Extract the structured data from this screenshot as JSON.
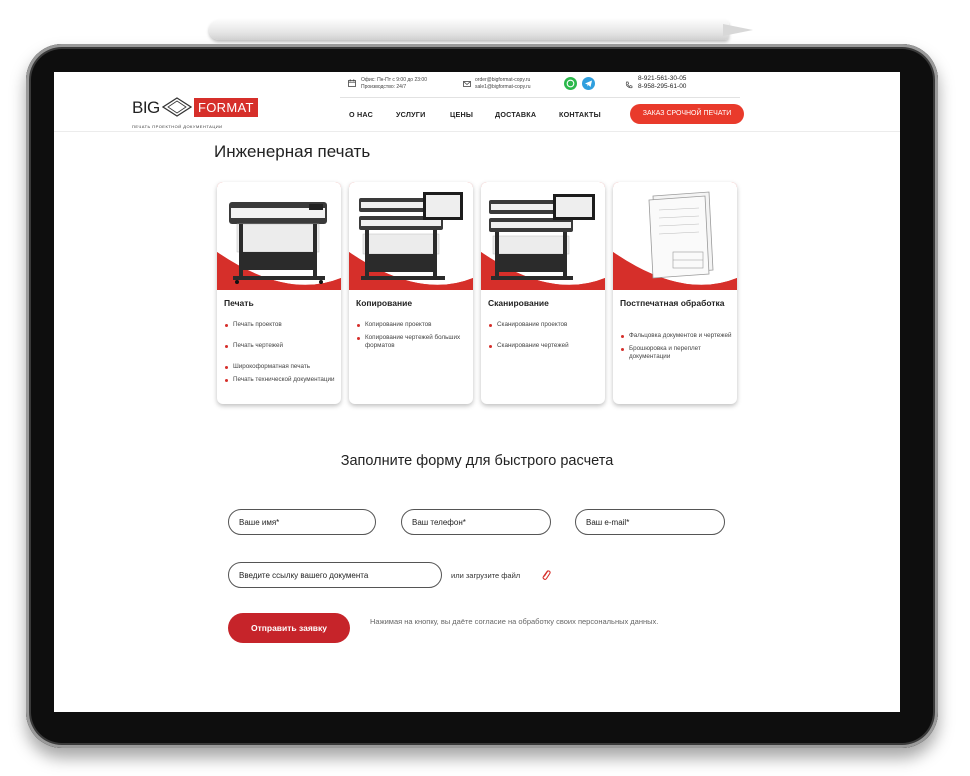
{
  "header": {
    "logo_big": "BIG",
    "logo_format": "FORMAT",
    "logo_sub": "ПЕЧАТЬ ПРОЕКТНОЙ ДОКУМЕНТАЦИИ",
    "hours_line1": "Офис: Пн-Пт с 9:00 до 23:00",
    "hours_line2": "Производство: 24/7",
    "email_line1": "order@bigformat-copy.ru",
    "email_line2": "sale1@bigformat-copy.ru",
    "phone_line1": "8-921-561-30-05",
    "phone_line2": "8-958-295-61-00",
    "nav": [
      "О НАС",
      "УСЛУГИ",
      "ЦЕНЫ",
      "ДОСТАВКА",
      "КОНТАКТЫ"
    ],
    "cta": "ЗАКАЗ СРОЧНОЙ ПЕЧАТИ"
  },
  "main": {
    "title": "Инженерная печать",
    "cards": [
      {
        "title": "Печать",
        "items": [
          "Печать проектов",
          "Печать чертежей",
          "Широкоформатная печать",
          "Печать технической документации"
        ]
      },
      {
        "title": "Копирование",
        "items": [
          "Копирование проектов",
          "Копирование чертежей больших форматов"
        ]
      },
      {
        "title": "Сканирование",
        "items": [
          "Сканирование проектов",
          "Сканирование чертежей"
        ]
      },
      {
        "title": "Постпечатная обработка",
        "items": [
          "Фальцовка документов и чертежей",
          "Брошюровка и переплет документации"
        ]
      }
    ]
  },
  "form": {
    "title": "Заполните форму для быстрого расчета",
    "name_placeholder": "Ваше имя*",
    "phone_placeholder": "Ваш телефон*",
    "email_placeholder": "Ваш e-mail*",
    "link_placeholder": "Введите ссылку вашего документа",
    "upload_text": "или загрузите файл",
    "submit": "Отправить заявку",
    "consent": "Нажимая на кнопку, вы даёте согласие на обработку своих персональных данных."
  },
  "colors": {
    "accent": "#d62f2a",
    "cta": "#e93a2b",
    "whatsapp": "#2bb84b",
    "telegram": "#2f9fde"
  },
  "icons": [
    "calendar-icon",
    "mail-icon",
    "whatsapp-icon",
    "telegram-icon",
    "phone-icon",
    "paperclip-icon",
    "stylus-icon"
  ]
}
